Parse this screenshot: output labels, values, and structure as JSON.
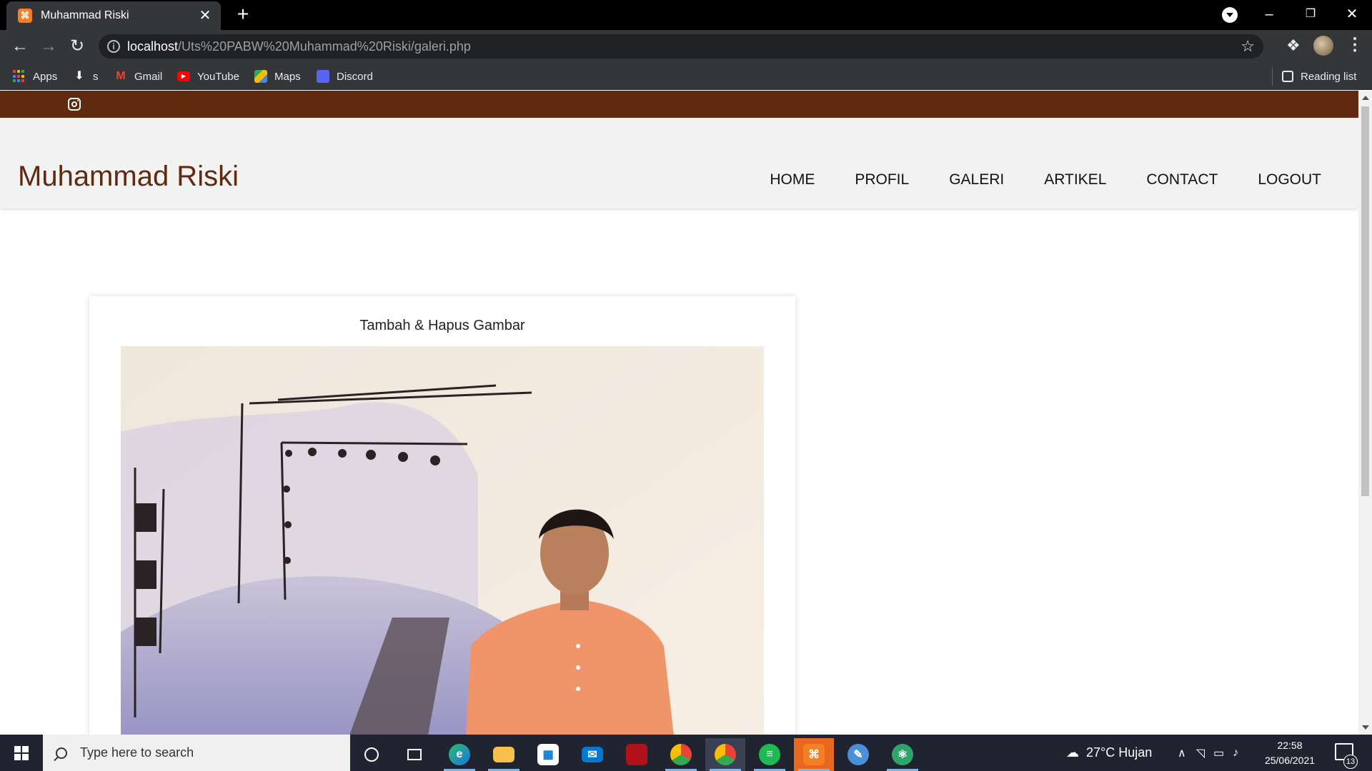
{
  "browser": {
    "tab_title": "Muhammad Riski",
    "tab_favicon": "xampp-icon",
    "url_host": "localhost",
    "url_path": "/Uts%20PABW%20Muhammad%20Riski/galeri.php",
    "bookmarks": [
      "Apps",
      "s",
      "Gmail",
      "YouTube",
      "Maps",
      "Discord"
    ],
    "reading_list": "Reading list"
  },
  "site": {
    "brand": "Muhammad Riski",
    "nav": [
      "HOME",
      "PROFIL",
      "GALERI",
      "ARTIKEL",
      "CONTACT",
      "LOGOUT"
    ],
    "card_title": "Tambah & Hapus Gambar",
    "colors": {
      "topbar": "#5f2a10",
      "brand": "#5f2a10",
      "header_bg": "#f2f2f2"
    }
  },
  "taskbar": {
    "search_placeholder": "Type here to search",
    "weather": "27°C  Hujan",
    "time": "22:58",
    "date": "25/06/2021",
    "notification_count": "13"
  }
}
